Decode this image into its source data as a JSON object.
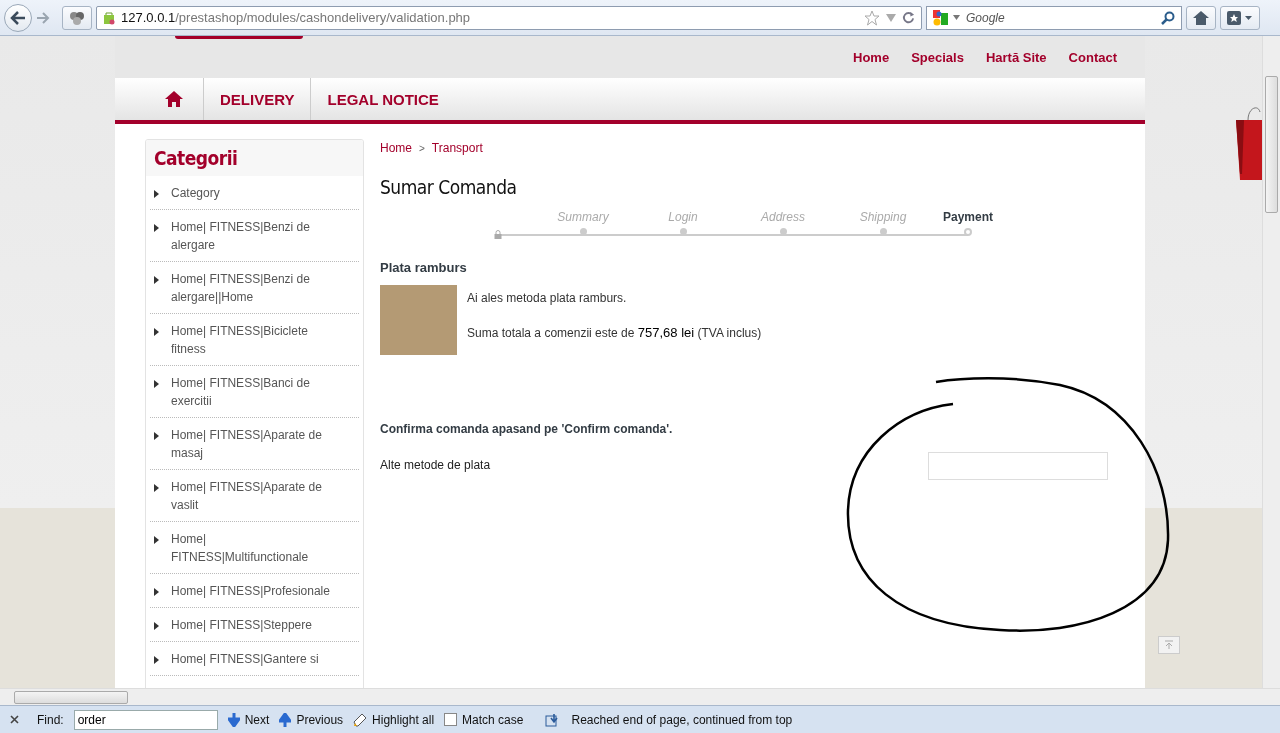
{
  "browser": {
    "url_host": "127.0.0.1",
    "url_path": "/prestashop/modules/cashondelivery/validation.php",
    "search_placeholder": "Google"
  },
  "top_links": [
    "Home",
    "Specials",
    "Hartă Site",
    "Contact"
  ],
  "nav": [
    "DELIVERY",
    "LEGAL NOTICE"
  ],
  "sidebar": {
    "title": "Categorii",
    "items": [
      "Category",
      "Home| FITNESS|Benzi de alergare",
      "Home| FITNESS|Benzi de alergare||Home",
      "Home| FITNESS|Biciclete fitness",
      "Home| FITNESS|Banci de exercitii",
      "Home| FITNESS|Aparate de masaj",
      "Home| FITNESS|Aparate de vaslit",
      "Home| FITNESS|Multifunctionale",
      "Home| FITNESS|Profesionale",
      "Home| FITNESS|Steppere",
      "Home| FITNESS|Gantere si"
    ]
  },
  "breadcrumb": [
    "Home",
    ">",
    "Transport"
  ],
  "page_title": "Sumar Comanda",
  "steps": [
    {
      "label": "Summary",
      "selected": false
    },
    {
      "label": "Login",
      "selected": false
    },
    {
      "label": "Address",
      "selected": false
    },
    {
      "label": "Shipping",
      "selected": false
    },
    {
      "label": "Payment",
      "selected": true
    }
  ],
  "payment": {
    "heading": "Plata ramburs",
    "lines": [
      "Ai ales metoda plata ramburs.",
      "Suma totala a comenzii este de **757,68 lei** (TVA inclus)"
    ],
    "confirm": "Confirma comanda apasand pe 'Confirm comanda'.",
    "other": "Alte metode de plata"
  },
  "find_bar": {
    "label": "Find:",
    "value": "order",
    "next": "Next",
    "previous": "Previous",
    "highlight": "Highlight all",
    "match_case": {
      "label": "Match case",
      "checked": false
    },
    "status": "Reached end of page, continued from top"
  }
}
